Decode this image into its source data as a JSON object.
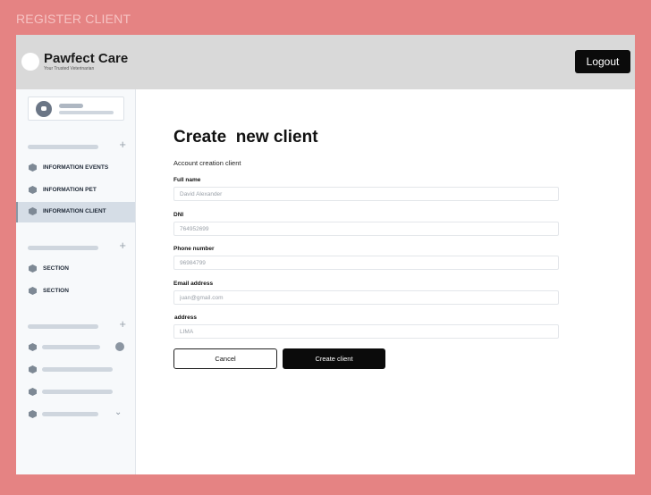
{
  "canvas_label": "REGISTER CLIENT",
  "header": {
    "brand": "Pawfect Care",
    "tagline": "Your Trusted Veterinarian",
    "logout_label": "Logout"
  },
  "sidebar": {
    "group1_items": [
      {
        "label": "INFORMATION EVENTS"
      },
      {
        "label": "INFORMATION PET"
      },
      {
        "label": "INFORMATION CLIENT",
        "active": true
      }
    ],
    "group2_items": [
      {
        "label": "SECTION"
      },
      {
        "label": "SECTION"
      }
    ],
    "add_icon": "plus-icon",
    "item_icon": "hexagon-icon"
  },
  "form": {
    "title": "Create  new client",
    "subtitle": "Account creation client",
    "fields": [
      {
        "label": "Full name",
        "placeholder": "David Alexander"
      },
      {
        "label": "DNI",
        "placeholder": "764952699"
      },
      {
        "label": "Phone number",
        "placeholder": "96984799"
      },
      {
        "label": "Email address",
        "placeholder": "juan@gmail.com"
      },
      {
        "label": "address",
        "placeholder": "LIMA"
      }
    ],
    "cancel_label": "Cancel",
    "submit_label": "Create client"
  },
  "colors": {
    "canvas_bg": "#e58383",
    "header_bg": "#d9d9d9",
    "sidebar_active": "#d5dde6",
    "primary_button": "#0b0b0b"
  }
}
